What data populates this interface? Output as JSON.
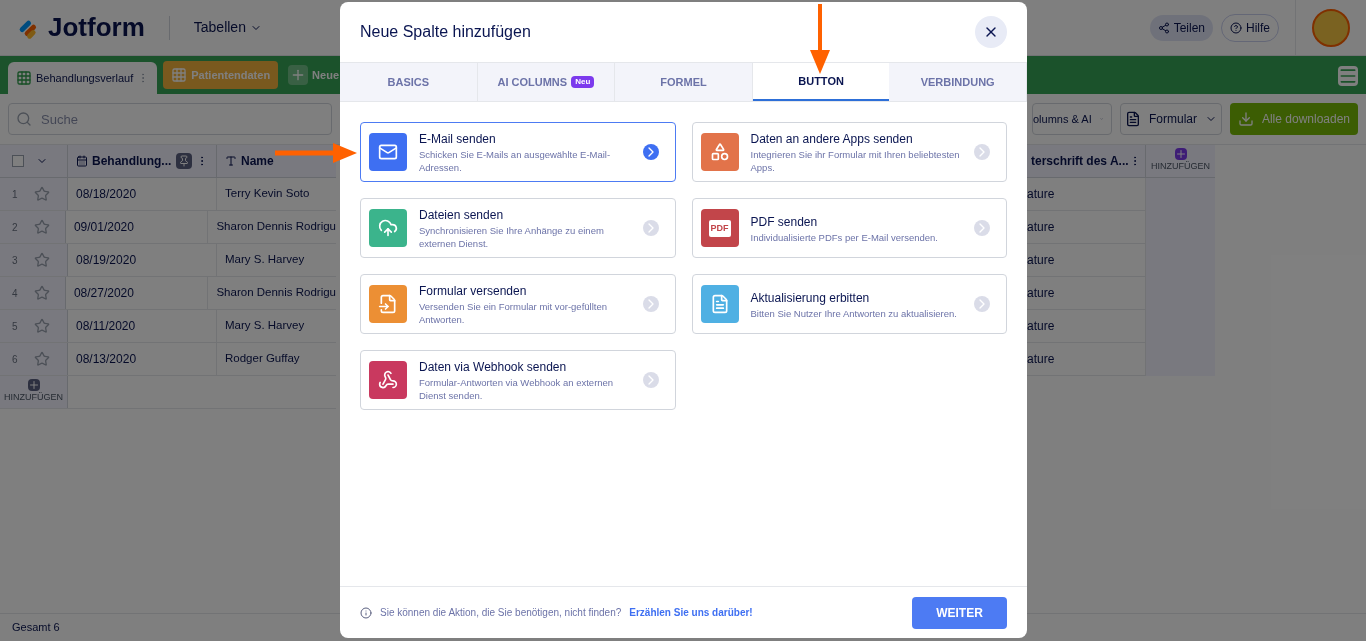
{
  "header": {
    "logo": "Jotform",
    "workspace": "Tabellen",
    "share": "Teilen",
    "help": "Hilfe"
  },
  "sheet_tabs": [
    {
      "label": "Behandlungsverlauf",
      "selected": true,
      "kind": "sheet"
    },
    {
      "label": "Patientendaten",
      "selected": false,
      "kind": "sheet"
    },
    {
      "label": "Neue",
      "kind": "add"
    }
  ],
  "toolbar": {
    "search_placeholder": "Suche",
    "buttons": [
      {
        "label": "olumns & AI",
        "kind": "dropdown"
      },
      {
        "label": "Formular",
        "kind": "form-dropdown"
      },
      {
        "label": "Alle downloaden",
        "kind": "download"
      }
    ]
  },
  "table": {
    "select_all_checked": false,
    "columns": [
      {
        "label": "Behandlung...",
        "kind": "date"
      },
      {
        "label": "Name",
        "kind": "text"
      }
    ],
    "right_column": "terschrift des A...",
    "add_column": "HINZUFÜGEN",
    "rows": [
      {
        "number": "1",
        "date": "08/18/2020",
        "name": "Terry Kevin Soto",
        "right": "ature"
      },
      {
        "number": "2",
        "date": "09/01/2020",
        "name": "Sharon Dennis Rodrigu",
        "right": "ature"
      },
      {
        "number": "3",
        "date": "08/19/2020",
        "name": "Mary S. Harvey",
        "right": "ature"
      },
      {
        "number": "4",
        "date": "08/27/2020",
        "name": "Sharon Dennis Rodrigu",
        "right": "ature"
      },
      {
        "number": "5",
        "date": "08/11/2020",
        "name": "Mary S. Harvey",
        "right": "ature"
      },
      {
        "number": "6",
        "date": "08/13/2020",
        "name": "Rodger Guffay",
        "right": "ature"
      }
    ],
    "add_row": "HINZUFÜGEN",
    "total": "Gesamt 6"
  },
  "modal": {
    "title": "Neue Spalte hinzufügen",
    "tabs": [
      {
        "label": "BASICS",
        "selected": false
      },
      {
        "label": "AI COLUMNS",
        "selected": false,
        "badge": "Neu"
      },
      {
        "label": "FORMEL",
        "selected": false
      },
      {
        "label": "BUTTON",
        "selected": true
      },
      {
        "label": "VERBINDUNG",
        "selected": false
      }
    ],
    "actions": [
      {
        "title": "E-Mail senden",
        "description": "Schicken Sie E-Mails an ausgewählte E-Mail-Adressen.",
        "kind": "email",
        "color": "#3e6ff2",
        "selected": true
      },
      {
        "title": "Daten an andere Apps senden",
        "description": "Integrieren Sie ihr Formular mit Ihren beliebtesten Apps.",
        "kind": "apps",
        "color": "#e2734a",
        "selected": false
      },
      {
        "title": "Dateien senden",
        "description": "Synchronisieren Sie Ihre Anhänge zu einem externen Dienst.",
        "kind": "files",
        "color": "#3bb48c",
        "selected": false
      },
      {
        "title": "PDF senden",
        "description": "Individualisierte PDFs per E-Mail versenden.",
        "kind": "pdf",
        "color": "#c2454a",
        "selected": false,
        "icon_label": "PDF"
      },
      {
        "title": "Formular versenden",
        "description": "Versenden Sie ein Formular mit vor-gefüllten Antworten.",
        "kind": "form",
        "color": "#ec8f34",
        "selected": false
      },
      {
        "title": "Aktualisierung erbitten",
        "description": "Bitten Sie Nutzer Ihre Antworten zu aktualisieren.",
        "kind": "update",
        "color": "#4fb0e3",
        "selected": false
      },
      {
        "title": "Daten via Webhook senden",
        "description": "Formular-Antworten via Webhook an externen Dienst senden.",
        "kind": "webhook",
        "color": "#c9395f",
        "selected": false
      }
    ],
    "footer_text": "Sie können die Aktion, die Sie benötigen, nicht finden?",
    "footer_link": "Erzählen Sie uns darüber!",
    "continue": "WEITER"
  }
}
